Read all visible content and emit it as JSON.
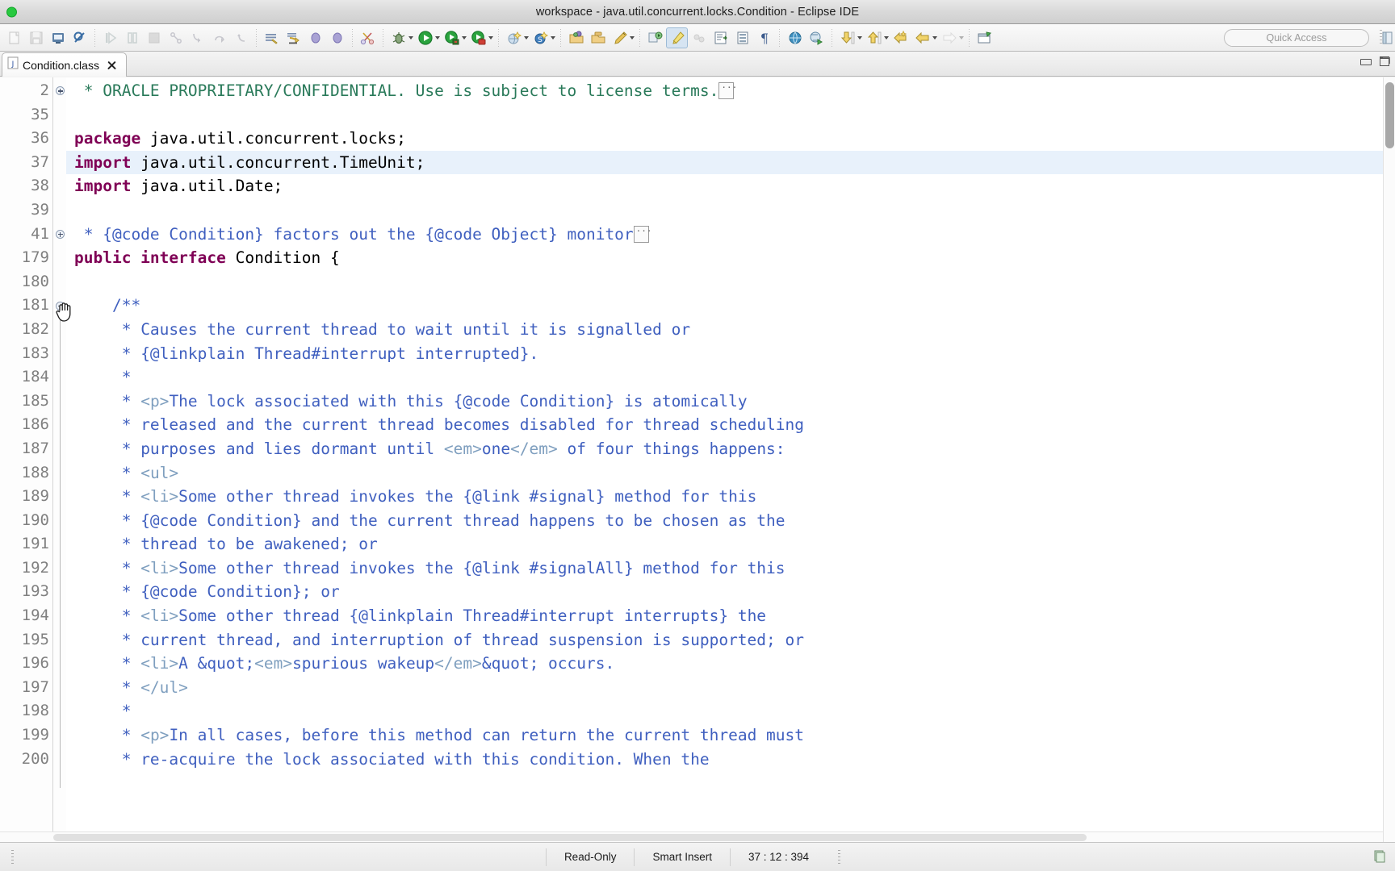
{
  "window": {
    "title": "workspace - java.util.concurrent.locks.Condition - Eclipse IDE",
    "minimize_label": "Minimize",
    "maximize_label": "Maximize"
  },
  "toolbar": {
    "quick_access_placeholder": "Quick Access",
    "quick_access_value": "",
    "items": [
      {
        "name": "new-icon",
        "enabled": false
      },
      {
        "name": "save-icon",
        "enabled": false
      },
      {
        "name": "save-all-icon",
        "enabled": true
      },
      {
        "name": "print-icon",
        "enabled": true
      },
      {
        "name": "resume-icon",
        "enabled": false
      },
      {
        "name": "suspend-icon",
        "enabled": false
      },
      {
        "name": "terminate-icon",
        "enabled": false
      },
      {
        "name": "disconnect-icon",
        "enabled": false
      },
      {
        "name": "step-into-icon",
        "enabled": false
      },
      {
        "name": "step-over-icon",
        "enabled": false
      },
      {
        "name": "step-return-icon",
        "enabled": false
      },
      {
        "name": "build-icon",
        "enabled": true
      },
      {
        "name": "skip-breakpoints-icon",
        "enabled": true
      },
      {
        "name": "next-annotation-icon",
        "enabled": true
      },
      {
        "name": "previous-annotation-icon",
        "enabled": true
      },
      {
        "name": "cut-icon",
        "enabled": true
      },
      {
        "name": "debug-icon",
        "enabled": true
      },
      {
        "name": "run-icon",
        "enabled": true
      },
      {
        "name": "run-external-tools-icon",
        "enabled": true
      },
      {
        "name": "coverage-icon",
        "enabled": true
      },
      {
        "name": "new-java-project-icon",
        "enabled": true
      },
      {
        "name": "new-scala-icon",
        "enabled": true
      },
      {
        "name": "open-type-icon",
        "enabled": true
      },
      {
        "name": "open-task-icon",
        "enabled": true
      },
      {
        "name": "pencil-icon",
        "enabled": true
      },
      {
        "name": "search-icon",
        "enabled": true
      },
      {
        "name": "marker-icon",
        "enabled": true
      },
      {
        "name": "link-icon",
        "enabled": false
      },
      {
        "name": "toggle-block-selection-icon",
        "enabled": true
      },
      {
        "name": "show-whitespace-icon",
        "enabled": true
      },
      {
        "name": "pilcrow-icon",
        "enabled": true
      },
      {
        "name": "browser-icon",
        "enabled": true
      },
      {
        "name": "search-browser-icon",
        "enabled": true
      },
      {
        "name": "next-edit-icon",
        "enabled": true
      },
      {
        "name": "previous-edit-icon",
        "enabled": true
      },
      {
        "name": "back-icon",
        "enabled": true
      },
      {
        "name": "back-history-icon",
        "enabled": true
      },
      {
        "name": "forward-icon",
        "enabled": false
      },
      {
        "name": "new-window-icon",
        "enabled": true
      }
    ]
  },
  "tab": {
    "label": "Condition.class",
    "close_label": "Close",
    "icon": "class-file-icon"
  },
  "editor": {
    "lines": [
      {
        "num": "2",
        "fold": "plus",
        "highlight": false,
        "indent": 0,
        "segments": [
          {
            "t": " * ORACLE PROPRIETARY/CONFIDENTIAL. Use is subject to license terms.",
            "c": "cmt"
          }
        ],
        "folded_box": true
      },
      {
        "num": "35",
        "fold": "",
        "highlight": false,
        "indent": 0,
        "segments": []
      },
      {
        "num": "36",
        "fold": "",
        "highlight": false,
        "indent": 0,
        "segments": [
          {
            "t": "package",
            "c": "kw"
          },
          {
            "t": " java.util.concurrent.locks;",
            "c": "plain"
          }
        ]
      },
      {
        "num": "37",
        "fold": "",
        "highlight": true,
        "indent": 0,
        "segments": [
          {
            "t": "import",
            "c": "kw"
          },
          {
            "t": " java.util.concurrent.TimeUnit;",
            "c": "plain"
          }
        ]
      },
      {
        "num": "38",
        "fold": "",
        "highlight": false,
        "indent": 0,
        "segments": [
          {
            "t": "import",
            "c": "kw"
          },
          {
            "t": " java.util.Date;",
            "c": "plain"
          }
        ]
      },
      {
        "num": "39",
        "fold": "",
        "highlight": false,
        "indent": 0,
        "segments": []
      },
      {
        "num": "41",
        "fold": "plus",
        "highlight": false,
        "indent": 0,
        "segments": [
          {
            "t": " * {@code Condition} factors out the {@code Object} monitor",
            "c": "jd"
          }
        ],
        "folded_box": true
      },
      {
        "num": "179",
        "fold": "",
        "highlight": false,
        "indent": 0,
        "segments": [
          {
            "t": "public interface",
            "c": "kw"
          },
          {
            "t": " Condition {",
            "c": "plain"
          }
        ]
      },
      {
        "num": "180",
        "fold": "",
        "highlight": false,
        "indent": 0,
        "segments": []
      },
      {
        "num": "181",
        "fold": "minus",
        "highlight": false,
        "indent": 1,
        "segments": [
          {
            "t": "/**",
            "c": "jd"
          }
        ]
      },
      {
        "num": "182",
        "fold": "",
        "highlight": false,
        "indent": 1,
        "segments": [
          {
            "t": " * Causes the current thread to wait until it is signalled or",
            "c": "jd"
          }
        ]
      },
      {
        "num": "183",
        "fold": "",
        "highlight": false,
        "indent": 1,
        "segments": [
          {
            "t": " * {@linkplain Thread#interrupt interrupted}.",
            "c": "jd"
          }
        ]
      },
      {
        "num": "184",
        "fold": "",
        "highlight": false,
        "indent": 1,
        "segments": [
          {
            "t": " *",
            "c": "jd"
          }
        ]
      },
      {
        "num": "185",
        "fold": "",
        "highlight": false,
        "indent": 1,
        "segments": [
          {
            "t": " * ",
            "c": "jd"
          },
          {
            "t": "<p>",
            "c": "jdl"
          },
          {
            "t": "The lock associated with this {@code Condition} is atomically",
            "c": "jd"
          }
        ]
      },
      {
        "num": "186",
        "fold": "",
        "highlight": false,
        "indent": 1,
        "segments": [
          {
            "t": " * released and the current thread becomes disabled for thread scheduling",
            "c": "jd"
          }
        ]
      },
      {
        "num": "187",
        "fold": "",
        "highlight": false,
        "indent": 1,
        "segments": [
          {
            "t": " * purposes and lies dormant until ",
            "c": "jd"
          },
          {
            "t": "<em>",
            "c": "jdl"
          },
          {
            "t": "one",
            "c": "jd"
          },
          {
            "t": "</em>",
            "c": "jdl"
          },
          {
            "t": " of four things happens:",
            "c": "jd"
          }
        ]
      },
      {
        "num": "188",
        "fold": "",
        "highlight": false,
        "indent": 1,
        "segments": [
          {
            "t": " * ",
            "c": "jd"
          },
          {
            "t": "<ul>",
            "c": "jdl"
          }
        ]
      },
      {
        "num": "189",
        "fold": "",
        "highlight": false,
        "indent": 1,
        "segments": [
          {
            "t": " * ",
            "c": "jd"
          },
          {
            "t": "<li>",
            "c": "jdl"
          },
          {
            "t": "Some other thread invokes the {@link #signal} method for this",
            "c": "jd"
          }
        ]
      },
      {
        "num": "190",
        "fold": "",
        "highlight": false,
        "indent": 1,
        "segments": [
          {
            "t": " * {@code Condition} and the current thread happens to be chosen as the",
            "c": "jd"
          }
        ]
      },
      {
        "num": "191",
        "fold": "",
        "highlight": false,
        "indent": 1,
        "segments": [
          {
            "t": " * thread to be awakened; or",
            "c": "jd"
          }
        ]
      },
      {
        "num": "192",
        "fold": "",
        "highlight": false,
        "indent": 1,
        "segments": [
          {
            "t": " * ",
            "c": "jd"
          },
          {
            "t": "<li>",
            "c": "jdl"
          },
          {
            "t": "Some other thread invokes the {@link #signalAll} method for this",
            "c": "jd"
          }
        ]
      },
      {
        "num": "193",
        "fold": "",
        "highlight": false,
        "indent": 1,
        "segments": [
          {
            "t": " * {@code Condition}; or",
            "c": "jd"
          }
        ]
      },
      {
        "num": "194",
        "fold": "",
        "highlight": false,
        "indent": 1,
        "segments": [
          {
            "t": " * ",
            "c": "jd"
          },
          {
            "t": "<li>",
            "c": "jdl"
          },
          {
            "t": "Some other thread {@linkplain Thread#interrupt interrupts} the",
            "c": "jd"
          }
        ]
      },
      {
        "num": "195",
        "fold": "",
        "highlight": false,
        "indent": 1,
        "segments": [
          {
            "t": " * current thread, and interruption of thread suspension is supported; or",
            "c": "jd"
          }
        ]
      },
      {
        "num": "196",
        "fold": "",
        "highlight": false,
        "indent": 1,
        "segments": [
          {
            "t": " * ",
            "c": "jd"
          },
          {
            "t": "<li>",
            "c": "jdl"
          },
          {
            "t": "A &quot;",
            "c": "jd"
          },
          {
            "t": "<em>",
            "c": "jdl"
          },
          {
            "t": "spurious wakeup",
            "c": "jd"
          },
          {
            "t": "</em>",
            "c": "jdl"
          },
          {
            "t": "&quot; occurs.",
            "c": "jd"
          }
        ]
      },
      {
        "num": "197",
        "fold": "",
        "highlight": false,
        "indent": 1,
        "segments": [
          {
            "t": " * ",
            "c": "jd"
          },
          {
            "t": "</ul>",
            "c": "jdl"
          }
        ]
      },
      {
        "num": "198",
        "fold": "",
        "highlight": false,
        "indent": 1,
        "segments": [
          {
            "t": " *",
            "c": "jd"
          }
        ]
      },
      {
        "num": "199",
        "fold": "",
        "highlight": false,
        "indent": 1,
        "segments": [
          {
            "t": " * ",
            "c": "jd"
          },
          {
            "t": "<p>",
            "c": "jdl"
          },
          {
            "t": "In all cases, before this method can return the current thread must",
            "c": "jd"
          }
        ]
      },
      {
        "num": "200",
        "fold": "",
        "highlight": false,
        "indent": 1,
        "segments": [
          {
            "t": " * re-acquire the lock associated with this condition. When the",
            "c": "jd"
          }
        ]
      }
    ]
  },
  "statusbar": {
    "read_only": "Read-Only",
    "insert_mode": "Smart Insert",
    "position": "37 : 12 : 394"
  },
  "colors": {
    "keyword": "#7f0055",
    "javadoc": "#3f5fbf",
    "javadoc_tag": "#7f9fbf",
    "comment": "#2a7a5a",
    "line_highlight": "#e8f1fb",
    "accent_green": "#28c940"
  }
}
